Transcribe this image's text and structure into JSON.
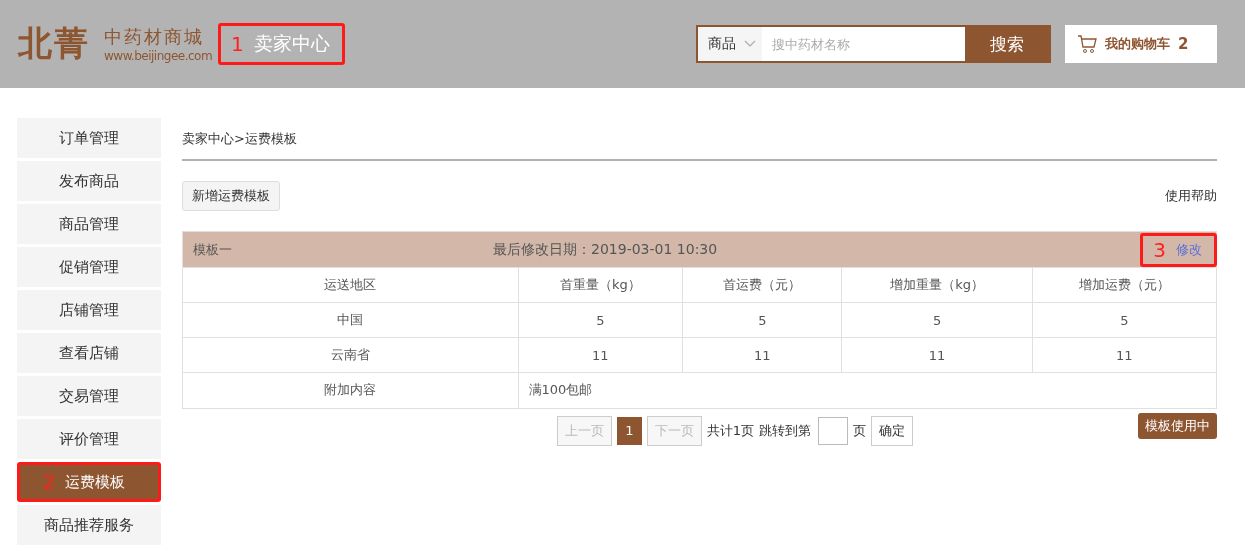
{
  "header": {
    "logo": {
      "mark": "北菁",
      "name": "中药材商城",
      "url": "www.beijingee.com"
    },
    "section_title": {
      "label": "卖家中心",
      "callout": "1"
    },
    "search": {
      "category": "商品",
      "placeholder": "搜中药材名称",
      "button": "搜索"
    },
    "cart": {
      "label": "我的购物车",
      "count": "2"
    }
  },
  "sidebar": {
    "items": [
      {
        "label": "订单管理",
        "selected": false
      },
      {
        "label": "发布商品",
        "selected": false
      },
      {
        "label": "商品管理",
        "selected": false
      },
      {
        "label": "促销管理",
        "selected": false
      },
      {
        "label": "店铺管理",
        "selected": false
      },
      {
        "label": "查看店铺",
        "selected": false
      },
      {
        "label": "交易管理",
        "selected": false
      },
      {
        "label": "评价管理",
        "selected": false
      },
      {
        "label": "运费模板",
        "selected": true,
        "callout": "2"
      },
      {
        "label": "商品推荐服务",
        "selected": false
      }
    ]
  },
  "breadcrumb": "卖家中心>运费模板",
  "toolbar": {
    "add_button": "新增运费模板",
    "help_link": "使用帮助"
  },
  "template": {
    "name": "模板一",
    "modified": "最后修改日期：2019-03-01 10:30",
    "edit_link": {
      "label": "修改",
      "callout": "3"
    },
    "columns": [
      "运送地区",
      "首重量（kg）",
      "首运费（元）",
      "增加重量（kg）",
      "增加运费（元）"
    ],
    "rows": [
      [
        "中国",
        "5",
        "5",
        "5",
        "5"
      ],
      [
        "云南省",
        "11",
        "11",
        "11",
        "11"
      ]
    ],
    "extra": {
      "label": "附加内容",
      "value": "满100包邮"
    }
  },
  "pagination": {
    "prev": {
      "label": "上一页",
      "disabled": true
    },
    "pages": [
      {
        "label": "1",
        "selected": true
      }
    ],
    "next": {
      "label": "下一页",
      "disabled": true
    },
    "total": "共计1页",
    "jump_label": "跳转到第",
    "page_unit": "页",
    "confirm": "确定"
  },
  "status_badge": "模板使用中"
}
